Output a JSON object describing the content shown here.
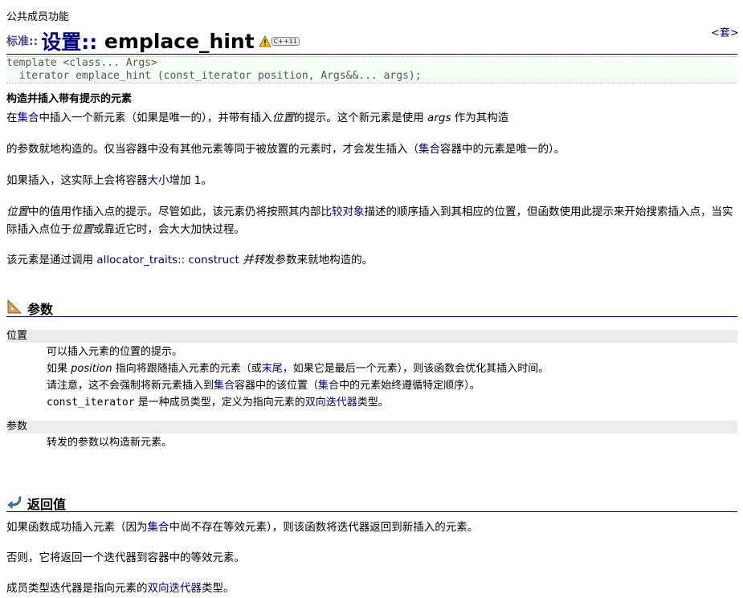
{
  "breadcrumb": "公共成员功能",
  "set_link": "<套>",
  "title": {
    "prefix": "标准::",
    "namespace": "设置::",
    "func": "emplace_hint",
    "badge": "C++11"
  },
  "prototype": {
    "line1": "template <class... Args>",
    "line2": "  iterator emplace_hint (const_iterator position, Args&&... args);"
  },
  "short_desc": "构造并插入带有提示的元素",
  "para1": {
    "a": "在",
    "link1": "集合",
    "b": "中插入一个新元素（如果是唯一的），并带有插入",
    "em1": "位置",
    "c": "的提示。这个新元素是使用 ",
    "em2": "args",
    "d": " 作为其构造"
  },
  "para2": {
    "a": "的参数就地构造的。仅当容器中没有其他元素等同于被放置的元素时，才会发生插入（",
    "link1": "集合",
    "b": "容器中的元素是唯一的）。"
  },
  "para3": {
    "a": "如果插入，这实际上会将容器",
    "link1": "大小",
    "b": "增加 1。"
  },
  "para4": {
    "em1": "位置",
    "a": "中的值用作插入点的提示。尽管如此，该元素仍将按照其内部",
    "link1": "比较对象",
    "b": "描述的顺序插入到其相应的位置，但函数使用此提示来开始搜索插入点，当实际插入点位于",
    "em2": "位置",
    "c": "或靠近它时，会大大加快过程。"
  },
  "para5": {
    "a": "该元素是通过调用 ",
    "link1": "allocator_traits:: construct",
    "em1": " 并转",
    "b": "发参数来就地构造的。"
  },
  "params_section": {
    "heading": "参数",
    "p1_name": "位置",
    "p1_l1": "可以插入元素的位置的提示。",
    "p1_l2": {
      "a": "如果 ",
      "em": "position",
      "b": " 指向将跟随插入元素的元素（或",
      "link": "末尾",
      "c": "，如果它是最后一个元素），则该函数会优化其插入时间。"
    },
    "p1_l3": {
      "a": "请注意，这不会强制将新元素插入到",
      "link1": "集合",
      "b": "容器中的该位置（",
      "link2": "集合",
      "c": "中的元素始终遵循特定顺序）。"
    },
    "p1_l4": {
      "mono": "const_iterator",
      "a": " 是一种成员类型，定义为指向元素的",
      "link": "双向迭代器",
      "b": "类型。"
    },
    "p2_name": "参数",
    "p2_l1": "转发的参数以构造新元素。"
  },
  "return_section": {
    "heading": "返回值",
    "r1": {
      "a": "如果函数成功插入元素（因为",
      "link": "集合",
      "b": "中尚不存在等效元素），则该函数将迭代器返回到新插入的元素。"
    },
    "r2": "否则，它将返回一个迭代器到容器中的等效元素。",
    "r3": {
      "a": "成员类型迭代器是指向元素的",
      "link": "双向迭代器",
      "b": "类型。"
    }
  },
  "colors": {
    "link": "#000080",
    "rule": "#000080",
    "code_bg": "#f5fff5",
    "param_bg": "#ececec"
  }
}
